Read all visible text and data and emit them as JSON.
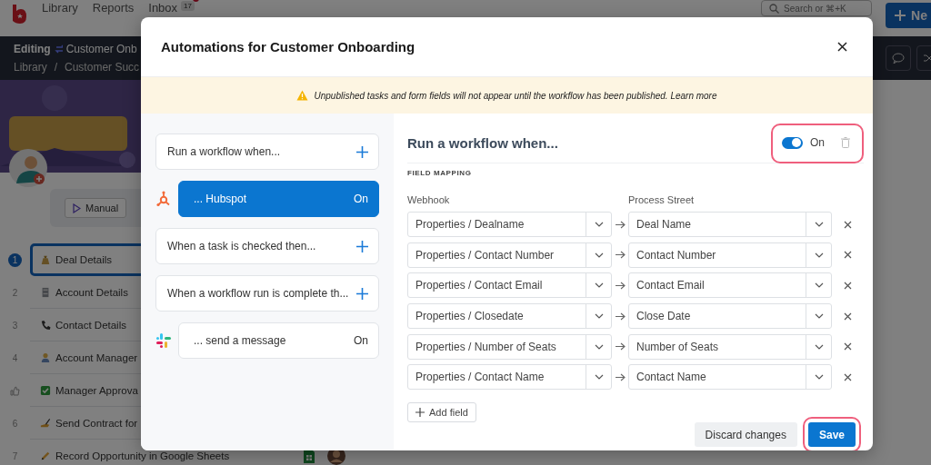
{
  "nav": {
    "links": [
      {
        "label": "Library"
      },
      {
        "label": "Reports"
      },
      {
        "label": "Inbox",
        "badge": "17"
      }
    ],
    "search": {
      "placeholder": "Search or ⌘+K"
    },
    "new_button": {
      "label": "Ne"
    }
  },
  "header": {
    "mode": "Editing",
    "title": "Customer Onb",
    "breadcrumb": [
      "Library",
      "Customer Succ"
    ],
    "breadcrumb_separator": "/"
  },
  "run_buttons": [
    {
      "label": "Manual"
    }
  ],
  "tasks": [
    {
      "kind": "numbered",
      "number": "1",
      "label": "Deal Details",
      "selected": true
    },
    {
      "kind": "numbered",
      "number": "2",
      "label": "Account Details",
      "selected": false
    },
    {
      "kind": "numbered",
      "number": "3",
      "label": "Contact Details",
      "selected": false
    },
    {
      "kind": "numbered",
      "number": "4",
      "label": "Account Manager",
      "selected": false
    },
    {
      "kind": "approval",
      "label": "Manager Approva",
      "selected": false
    },
    {
      "kind": "numbered",
      "number": "6",
      "label": "Send Contract for",
      "selected": false
    },
    {
      "kind": "numbered",
      "number": "7",
      "label": "Record Opportunity in Google Sheets",
      "selected": false,
      "sheet": true,
      "assignee": true
    }
  ],
  "modal": {
    "title": "Automations for Customer Onboarding",
    "notice": "Unpublished tasks and form fields will not appear until the workflow has been published.",
    "notice_link": "Learn more",
    "triggers": [
      {
        "kind": "add",
        "label": "Run a workflow when..."
      },
      {
        "kind": "integration",
        "label": "... Hubspot",
        "status": "On",
        "selected": true
      },
      {
        "kind": "add",
        "label": "When a task is checked then..."
      },
      {
        "kind": "add",
        "label": "When a workflow run is complete th..."
      },
      {
        "kind": "integration",
        "label": "... send a message",
        "status": "On",
        "selected": false
      }
    ],
    "panel": {
      "title": "Run a workflow when...",
      "toggle": {
        "label": "On",
        "on": true,
        "highlighted": true
      },
      "section": "FIELD MAPPING",
      "columns": [
        "Webhook",
        "Process Street"
      ],
      "mappings": [
        {
          "source": "Properties / Dealname",
          "target": "Deal Name"
        },
        {
          "source": "Properties / Contact Number",
          "target": "Contact Number"
        },
        {
          "source": "Properties / Contact Email",
          "target": "Contact Email"
        },
        {
          "source": "Properties / Closedate",
          "target": "Close Date"
        },
        {
          "source": "Properties / Number of Seats",
          "target": "Number of Seats"
        },
        {
          "source": "Properties / Contact Name",
          "target": "Contact Name"
        }
      ],
      "add_button": "Add field"
    },
    "footer": {
      "discard": "Discard changes",
      "save": {
        "label": "Save",
        "highlighted": true
      }
    }
  }
}
